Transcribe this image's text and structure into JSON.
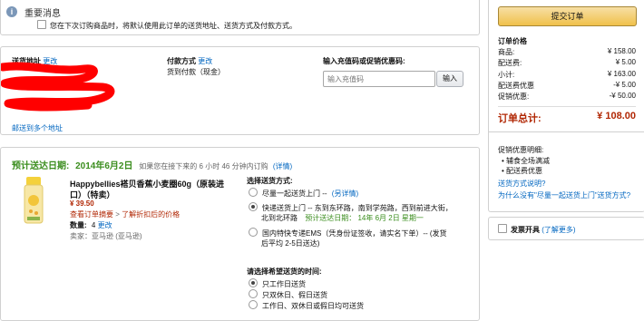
{
  "notice": {
    "title": "重要消息",
    "text": "您在下次订购商品时，将默认使用此订单的送货地址、送货方式及付款方式。"
  },
  "address": {
    "label": "送货地址",
    "change": "更改",
    "footer_link": "邮送到多个地址"
  },
  "payment": {
    "label": "付款方式",
    "change": "更改",
    "value": "货到付款（现金）"
  },
  "coupon": {
    "label": "输入充值码或促销优惠码:",
    "placeholder": "输入充值码",
    "button": "输入"
  },
  "delivery": {
    "label": "预计送达日期:",
    "date": "2014年6月2日",
    "note_before": "如果您在接下来的",
    "hours": "6",
    "note_mid1": "小时",
    "minutes": "46",
    "note_mid2": "分钟内订购",
    "detail": "(详情)"
  },
  "item": {
    "name_line1": "Happybellies褡贝香蕉小麦圈60g（原装进",
    "name_line2": "口）（特卖）",
    "price": "¥ 39.50",
    "promo_link1": "查看订单摘要",
    "promo_link2": "了解折扣后的价格",
    "qty_label": "数量:",
    "qty": "4",
    "qty_change": "更改",
    "seller": "卖家：亚马逊 (亚马逊)"
  },
  "shipping": {
    "title": "选择送货方式:",
    "options": [
      {
        "text": "尽量一起送货上门 --",
        "link": "(另详情)",
        "selected": false
      },
      {
        "line1": "快递送货上门 -- 东到东环路，南到学苑路，西到前进大街，",
        "line2a": "北到北环路",
        "line2b": "预计送达日期：  14年 6月 2日 星期一",
        "selected": true
      },
      {
        "line1": "国内特快专递EMS（凭身份证签收，请实名下单）--  (发货",
        "line2": "后平均 2-5日送达)",
        "selected": false
      }
    ]
  },
  "time": {
    "title": "请选择希望送货的时间:",
    "options": [
      {
        "text": "只工作日送货",
        "selected": true
      },
      {
        "text": "只双休日、假日送货",
        "selected": false
      },
      {
        "text": "工作日、双休日或假日均可送货",
        "selected": false
      }
    ]
  },
  "summary": {
    "submit": "提交订单",
    "title": "订单价格",
    "rows": [
      {
        "label": "商品:",
        "value": "¥ 158.00"
      },
      {
        "label": "配送费:",
        "value": "¥ 5.00"
      },
      {
        "label": "小计:",
        "value": "¥ 163.00"
      },
      {
        "label": "配送费优惠",
        "value": "-¥ 5.00"
      },
      {
        "label": "促销优惠:",
        "value": "-¥ 50.00"
      }
    ],
    "total_label": "订单总计:",
    "total_value": "¥ 108.00",
    "promo_title": "促销优惠明细:",
    "promo_items": [
      "辅食全场满减",
      "配送费优惠"
    ],
    "shipping_link": "送货方式说明?",
    "why_link": "为什么没有\"尽量一起送货上门\"送货方式?",
    "invoice_label": "发票开具",
    "invoice_link": "(了解更多)"
  },
  "colors": {
    "accent_red": "#b12704",
    "link_blue": "#0066c0",
    "delivery_green": "#3a8d1d",
    "redact_red": "#ff0000",
    "button_yellow": "#f0c14b"
  }
}
